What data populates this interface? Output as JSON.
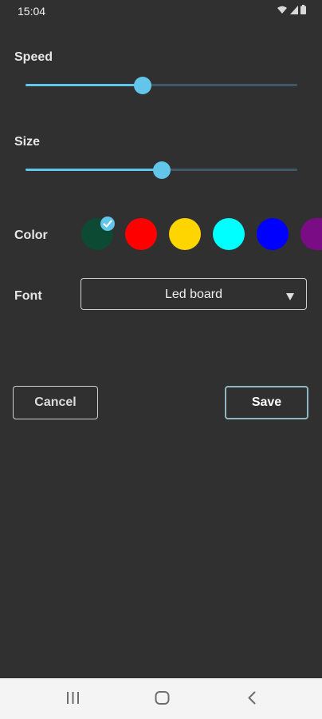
{
  "status_bar": {
    "time": "15:04",
    "icons": [
      "wifi-icon",
      "signal-icon",
      "battery-icon"
    ]
  },
  "speed": {
    "label": "Speed",
    "value_fraction": 0.43
  },
  "size": {
    "label": "Size",
    "value_fraction": 0.5
  },
  "color": {
    "label": "Color",
    "swatches": [
      {
        "name": "dark-green",
        "hex": "#0c4a33",
        "selected": true
      },
      {
        "name": "red",
        "hex": "#ff0000",
        "selected": false
      },
      {
        "name": "yellow",
        "hex": "#ffd500",
        "selected": false
      },
      {
        "name": "cyan",
        "hex": "#00ffff",
        "selected": false
      },
      {
        "name": "blue",
        "hex": "#0000ff",
        "selected": false
      },
      {
        "name": "purple",
        "hex": "#7a0c86",
        "selected": false
      }
    ],
    "selected_icon": "check-icon"
  },
  "font": {
    "label": "Font",
    "selected": "Led board",
    "dropdown_icon": "triangle-down-icon"
  },
  "actions": {
    "cancel_label": "Cancel",
    "save_label": "Save"
  },
  "nav_bar": {
    "buttons": [
      "recent-apps-icon",
      "home-icon",
      "back-icon"
    ]
  },
  "theme": {
    "background": "#303030",
    "accent": "#62c5ea"
  }
}
